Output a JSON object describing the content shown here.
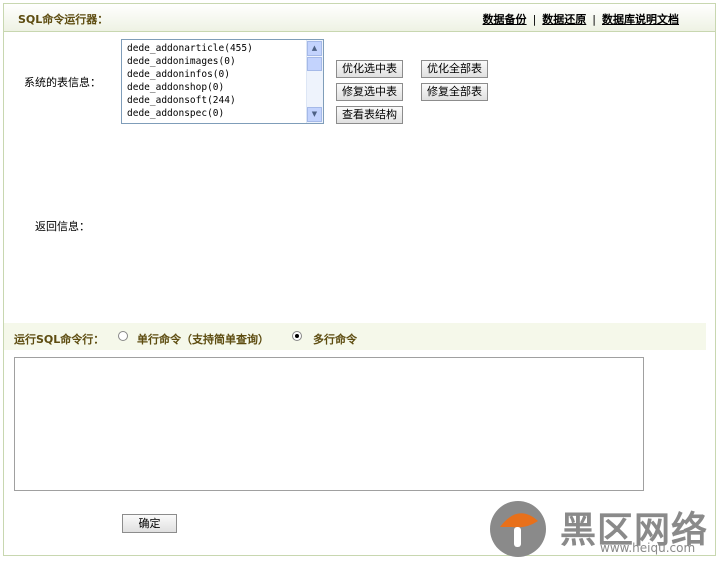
{
  "header": {
    "title": "SQL命令运行器：",
    "links": [
      "数据备份",
      "数据还原",
      "数据库说明文档"
    ],
    "separator": "|"
  },
  "tables": {
    "label": "系统的表信息：",
    "items": [
      "dede_addonarticle(455)",
      "dede_addonimages(0)",
      "dede_addoninfos(0)",
      "dede_addonshop(0)",
      "dede_addonsoft(244)",
      "dede_addonspec(0)"
    ]
  },
  "actions": {
    "optimize_selected": "优化选中表",
    "optimize_all": "优化全部表",
    "repair_selected": "修复选中表",
    "repair_all": "修复全部表",
    "view_structure": "查看表结构"
  },
  "result": {
    "label": "返回信息："
  },
  "run": {
    "title": "运行SQL命令行：",
    "single_label": "单行命令（支持简单查询）",
    "multi_label": "多行命令",
    "selected": "multi"
  },
  "submit_label": "确定",
  "watermark": {
    "brand": "黑区网络",
    "url": "www.heiqu.com"
  },
  "colors": {
    "accent_text": "#5d4c10",
    "border": "#c8d7b0",
    "bar": "#f5f8ea",
    "logo_orange": "#e8701a"
  }
}
